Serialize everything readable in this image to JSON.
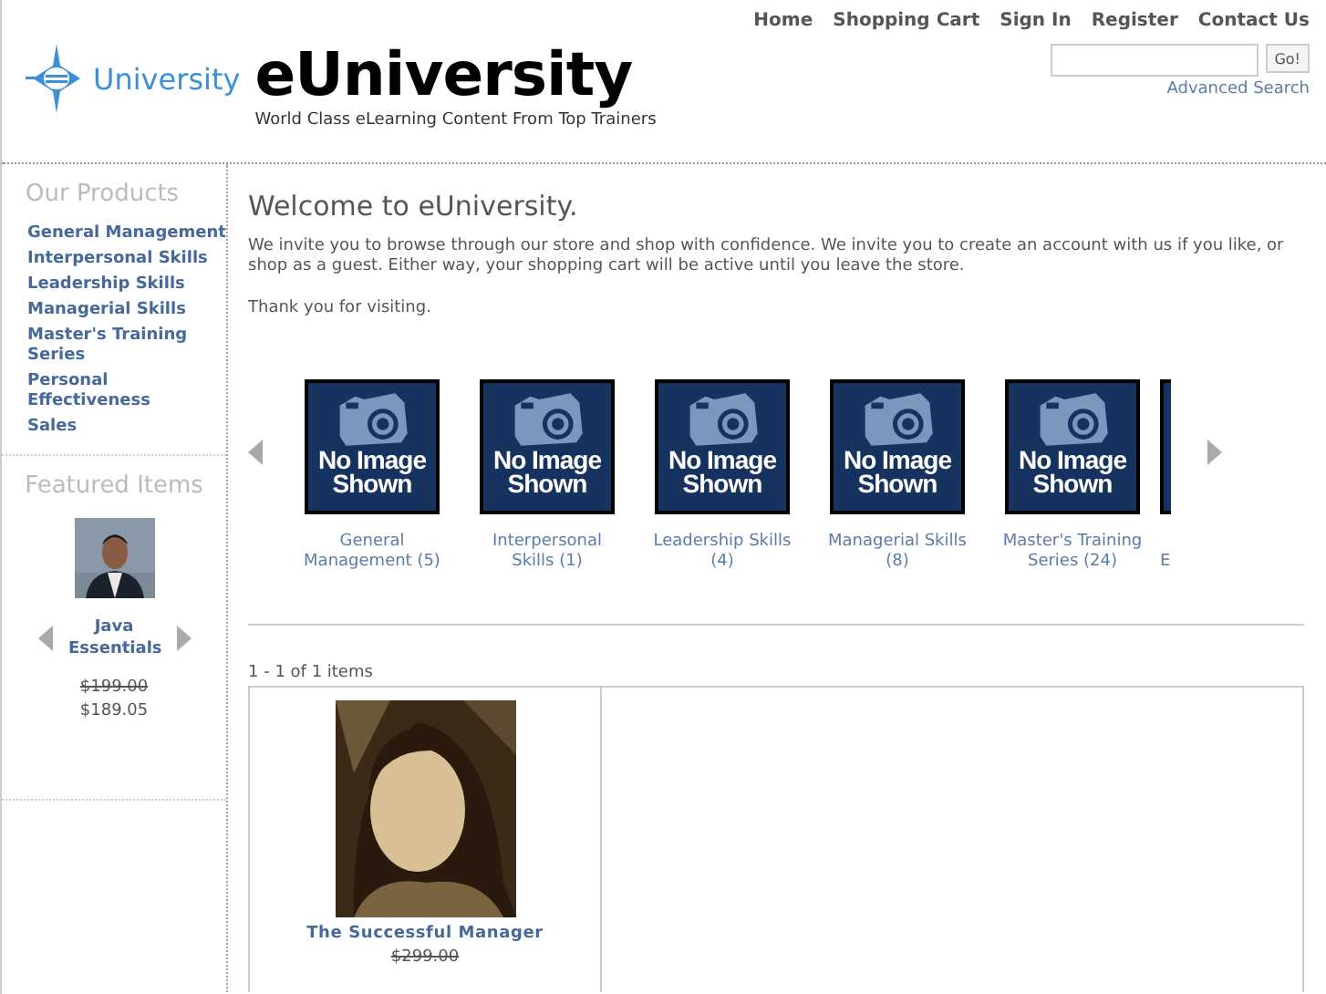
{
  "header": {
    "logo_text": "University",
    "site_title": "eUniversity",
    "tagline": "World Class eLearning Content From Top Trainers",
    "nav": [
      "Home",
      "Shopping Cart",
      "Sign In",
      "Register",
      "Contact Us"
    ],
    "search": {
      "button": "Go!",
      "advanced_link": "Advanced Search"
    }
  },
  "sidebar": {
    "products_heading": "Our Products",
    "products": [
      "General Management",
      "Interpersonal Skills",
      "Leadership Skills",
      "Managerial Skills",
      "Master's Training Series",
      "Personal Effectiveness",
      "Sales"
    ],
    "featured_heading": "Featured Items",
    "featured": {
      "kind": "picture",
      "title": "Java Essentials",
      "old_price": "$199.00",
      "price": "$189.05"
    }
  },
  "main": {
    "heading": "Welcome to eUniversity.",
    "paragraphs": [
      "We invite you to browse through our store and shop with confidence. We invite you to create an account with us if you like, or shop as a guest. Either way, your shopping cart will be active until you leave the store.",
      "Thank you for visiting."
    ],
    "categories": [
      {
        "kind": "full",
        "image_text": "No Image Shown",
        "label": "General Management (5)"
      },
      {
        "kind": "full",
        "image_text": "No Image Shown",
        "label": "Interpersonal Skills (1)"
      },
      {
        "kind": "full",
        "image_text": "No Image Shown",
        "label": "Leadership Skills (4)"
      },
      {
        "kind": "full",
        "image_text": "No Image Shown",
        "label": "Managerial Skills (8)"
      },
      {
        "kind": "full",
        "image_text": "No Image Shown",
        "label": "Master's Training Series (24)"
      },
      {
        "kind": "partial",
        "label": "E"
      }
    ],
    "pager": "1 - 1 of 1 items",
    "products": [
      {
        "kind": "picture",
        "title": "The Successful Manager",
        "old_price": "$299.00"
      }
    ]
  }
}
